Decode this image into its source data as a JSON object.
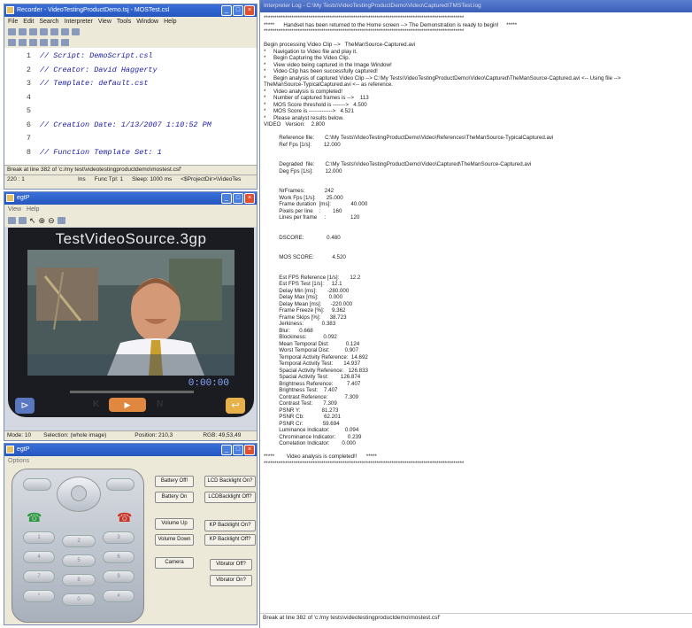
{
  "recorder": {
    "title": "Recorder - VideoTestingProductDemo.tsj - MOSTest.csl",
    "menu": [
      "File",
      "Edit",
      "Search",
      "Interpreter",
      "View",
      "Tools",
      "Window",
      "Help"
    ],
    "code": [
      {
        "n": "1",
        "t": "// Script: DemoScript.csl"
      },
      {
        "n": "2",
        "t": "// Creator: David Haggerty"
      },
      {
        "n": "3",
        "t": "// Template: default.cst"
      },
      {
        "n": "4",
        "t": ""
      },
      {
        "n": "5",
        "t": ""
      },
      {
        "n": "6",
        "t": "// Creation Date: 1/13/2007 1:10:52 PM"
      },
      {
        "n": "7",
        "t": ""
      },
      {
        "n": "8",
        "t": "// Function Template Set: 1"
      }
    ],
    "status_break": "Break at line 382 of 'c:/my test\\videotestingproductdemo\\mostest.csf'",
    "status_pos": "220 : 1",
    "status_ins": "Ins",
    "status_func": "Func Tpl: 1",
    "status_sleep": "Sleep: 1000 ms",
    "status_dir": "<$ProjectDir>\\VideoTes"
  },
  "player": {
    "title": "egtP",
    "menu": [
      "View",
      "Help"
    ],
    "video_title": "TestVideoSource.3gp",
    "time": "0:00:00",
    "status_mode": "Mode: 10",
    "status_sel": "Selection: (whole image)",
    "status_position": "Position: 210,3",
    "status_rgb": "RGB: 49,53,49"
  },
  "phone": {
    "title": "egtP",
    "menu": "Options",
    "buttons": {
      "battery_off": "Battery Off!",
      "battery_on": "Battery On",
      "lcd_on": "LCD Backlight On?",
      "lcd_off": "LCDBacklight Off?",
      "volume_up": "Volume Up",
      "volume_down": "Volume Down",
      "kp_on": "KP Backlight On?",
      "kp_off": "KP Backlight Off?",
      "camera": "Camera",
      "vib_off": "Vibrator Off?",
      "vib_on": "Vibrator On?"
    },
    "keys": [
      "1",
      "2",
      "3",
      "4",
      "5",
      "6",
      "7",
      "8",
      "9",
      "*",
      "0",
      "#"
    ]
  },
  "log": {
    "title": "Interpreter Log - C:\\My Tests\\VideoTestingProductDemo\\Video\\Captured\\TMSTest.log",
    "lines": [
      "**********************************************************************************************",
      "*****      Handset has been returned to the Home screen --> The Demonstration is ready to begin!     *****",
      "**********************************************************************************************",
      "",
      "Begin processing Video Clip -->   TheManSource-Captured.avi",
      "*     Navigation to Video file and play it.",
      "*     Begin Capturing the Video Clip.",
      "*     View video being captured in the Image Window!",
      "*     Video Clip has been successfully captured!",
      "*     Begin analysis of captured Video Clip --> C:\\My Tests\\VideoTestingProductDemo\\Video\\Captured\\TheManSource-Captured.avi <-- Using file -->",
      "TheManSource-TypicalCaptured.avi <-- as reference.",
      "*     Video analysis is completed!",
      "*     Number of captured frames is -->    113",
      "*     MOS Score threshold is ------->   4.500",
      "*     MOS Score is ------------->   4.521",
      "*     Please analyst results below.",
      "VIDEO   Version:    2.800",
      "",
      "          Reference file:       C:\\My Tests\\VideoTestingProductDemo\\Video\\References\\TheManSource-TypicalCaptured.avi",
      "          Ref Fps [1/s]:        12.000",
      "",
      "",
      "          Degraded  file:       C:\\My Tests\\VideoTestingProductDemo\\Video\\Captured\\TheManSource-Captured.avi",
      "          Deg Fps [1/s]:        12.000",
      "",
      "",
      "          NrFrames:             242",
      "          Work Fps [1/s]:       25.000",
      "          Frame duration  [ms]:             40.000",
      "          Pixels per line    :        160",
      "          Lines per frame     :                120",
      "",
      "",
      "          DSCORE:               0.480",
      "",
      "",
      "          MOS SCORE:            4.520",
      "",
      "",
      "          Est FPS Reference [1/s]:       12.2",
      "          Est FPS Test [1/s]:     12.1",
      "          Delay Min [ms]:       -280.000",
      "          Delay Max [ms]:       0.000",
      "          Delay Mean [ms]:      -220.000",
      "          Frame Freeze [%]:     9.362",
      "          Frame Skips [%]:      38.723",
      "          Jerkiness:            0.383",
      "          Blur:      0.668",
      "          Blockiness:           0.092",
      "          Mean Temporal Dist:           0.124",
      "          Worst Temporal Dist:          0.907",
      "          Temporal Activity Reference:  14.692",
      "          Temporal Activity Test:       14.937",
      "          Spacial Activity Reference:   126.833",
      "          Spacial Activity Test:        126.874",
      "          Brightness Reference:         7.407",
      "          Brightness Test:    7.407",
      "          Contrast Reference:           7.309",
      "          Contrast Test:       7.309",
      "          PSNR Y:              81.273",
      "          PSNR Cb:             62.201",
      "          PSNR Cr:             59.694",
      "          Luminance Indicator:          0.094",
      "          Chrominance Indicator:        0.239",
      "          Correlation Indicator:        0.000",
      "",
      "*****        Video analysis is completed!!      *****",
      "**********************************************************************************************"
    ],
    "status": "Break at line 382 of 'c:/my tests\\videotestingproductdemo\\mostest.csf'"
  }
}
